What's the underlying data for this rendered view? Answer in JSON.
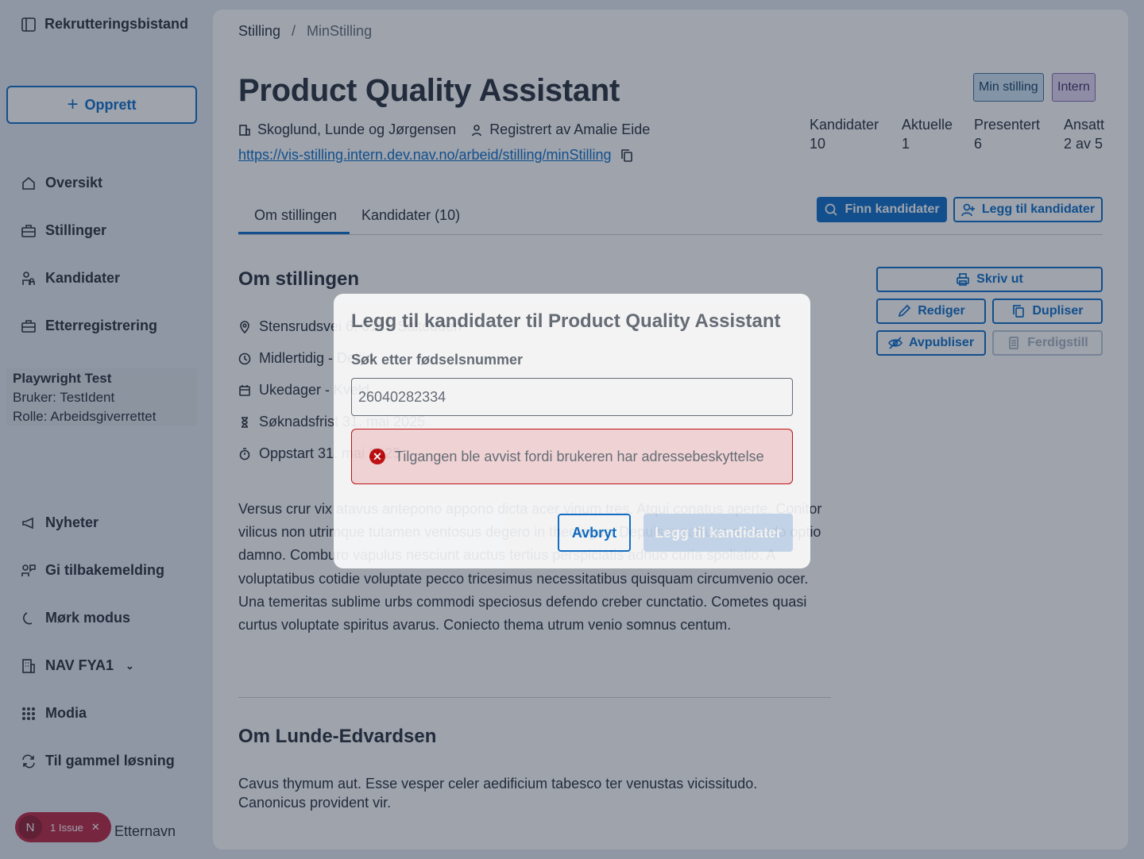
{
  "sidebar": {
    "brand": "Rekrutteringsbistand",
    "create_label": "Opprett",
    "items": [
      {
        "label": "Oversikt",
        "icon": "house-icon"
      },
      {
        "label": "Stillinger",
        "icon": "briefcase-icon"
      },
      {
        "label": "Kandidater",
        "icon": "persons-icon"
      },
      {
        "label": "Etterregistrering",
        "icon": "briefcase-icon"
      }
    ],
    "user": {
      "name": "Playwright Test",
      "ident": "Bruker: TestIdent",
      "role": "Rolle: Arbeidsgiverrettet"
    },
    "bottom_items": [
      {
        "label": "Nyheter",
        "icon": "megaphone-icon"
      },
      {
        "label": "Gi tilbakemelding",
        "icon": "feedback-icon"
      },
      {
        "label": "Mørk modus",
        "icon": "moon-icon"
      },
      {
        "label": "NAV FYA1",
        "icon": "building-icon"
      },
      {
        "label": "Modia",
        "icon": "grid-icon"
      },
      {
        "label": "Til gammel løsning",
        "icon": "arrows-icon"
      }
    ],
    "footer_name": "Etternavn"
  },
  "dev_overlay": {
    "avatar": "N",
    "label": "1 Issue",
    "close": "✕"
  },
  "breadcrumb": {
    "root": "Stilling",
    "sep": "/",
    "current": "MinStilling"
  },
  "page": {
    "title": "Product Quality Assistant",
    "employer": "Skoglund, Lunde og Jørgensen",
    "registered_by": "Registrert av Amalie Eide",
    "url": "https://vis-stilling.intern.dev.nav.no/arbeid/stilling/minStilling",
    "tags": [
      "Min stilling",
      "Intern"
    ],
    "stats": [
      {
        "label": "Kandidater",
        "value": "10"
      },
      {
        "label": "Aktuelle",
        "value": "1"
      },
      {
        "label": "Presentert",
        "value": "6"
      },
      {
        "label": "Ansatt",
        "value": "2 av 5"
      }
    ]
  },
  "tabs": {
    "about": "Om stillingen",
    "candidates": "Kandidater (10)"
  },
  "actions": {
    "find": "Finn kandidater",
    "add": "Legg til kandidater",
    "print": "Skriv ut",
    "edit": "Rediger",
    "duplicate": "Dupliser",
    "unpublish": "Avpubliser",
    "finish": "Ferdigstill"
  },
  "about": {
    "heading": "Om stillingen",
    "address": "Stensrudsvei 6, 0135 Saltodden",
    "employment": "Midlertidig - Deltid",
    "workdays": "Ukedager - Kveld",
    "deadline": "Søknadsfrist 31. mai 2025",
    "start": "Oppstart 31. mai 2025",
    "description": "Versus crur vix atavus antepono appono dicta acer vinum tres. Atqui conatus aperte. Conitor vilicus non utrimque tutamen ventosus degero in theologus. Depulsor patruus accendo optio damno. Comburo vapulus nesciunt auctus tertius perspiciatis adnuo curia spoliatio. A voluptatibus cotidie voluptate pecco tricesimus necessitatibus quisquam circumvenio ocer. Una temeritas sublime urbs commodi speciosus defendo creber cunctatio. Cometes quasi curtus voluptate spiritus avarus. Coniecto thema utrum venio somnus centum."
  },
  "employer_section": {
    "heading": "Om Lunde-Edvardsen",
    "description": "Cavus thymum aut. Esse vesper celer aedificium tabesco ter venustas vicissitudo. Canonicus provident vir."
  },
  "modal": {
    "title": "Legg til kandidater til Product Quality Assistant",
    "search_label": "Søk etter fødselsnummer",
    "search_value": "26040282334",
    "error": "Tilgangen ble avvist fordi brukeren har adressebeskyttelse",
    "cancel": "Avbryt",
    "submit": "Legg til kandidater"
  }
}
